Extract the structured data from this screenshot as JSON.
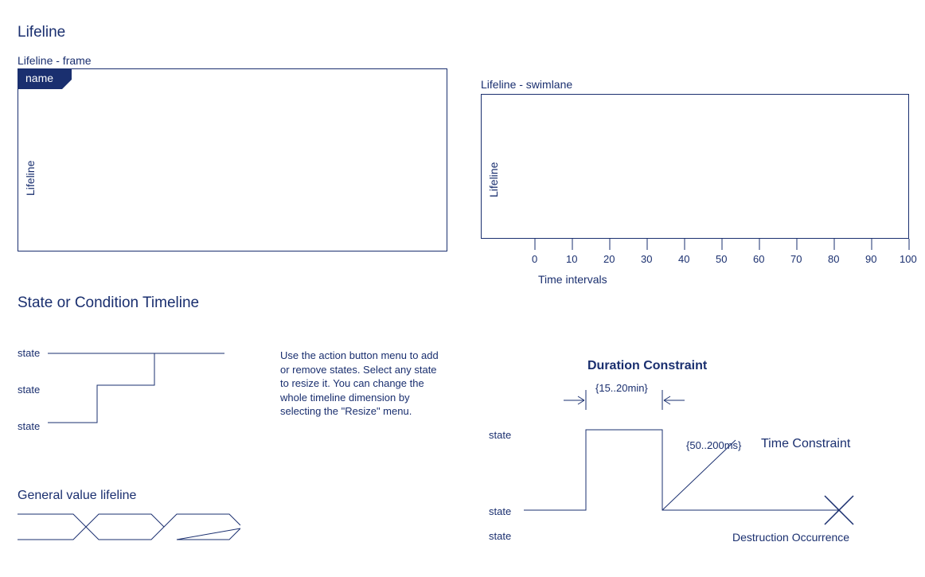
{
  "headings": {
    "lifeline": "Lifeline",
    "state_timeline": "State or Condition Timeline",
    "general_value": "General value lifeline",
    "duration_constraint": "Duration Constraint",
    "time_constraint": "Time Constraint",
    "destruction": "Destruction Occurrence"
  },
  "labels": {
    "lifeline_frame": "Lifeline - frame",
    "lifeline_swimlane": "Lifeline - swimlane",
    "name_tab": "name",
    "lifeline_vert": "Lifeline",
    "time_intervals": "Time intervals",
    "state": "state",
    "duration_value": "{15..20min}",
    "time_value": "{50..200ms}"
  },
  "help_text": "Use the action button menu to add or remove states. Select any state to resize it. You can change the whole timeline dimension by selecting the \"Resize\" menu.",
  "axis_ticks": [
    "0",
    "10",
    "20",
    "30",
    "40",
    "50",
    "60",
    "70",
    "80",
    "90",
    "100"
  ]
}
